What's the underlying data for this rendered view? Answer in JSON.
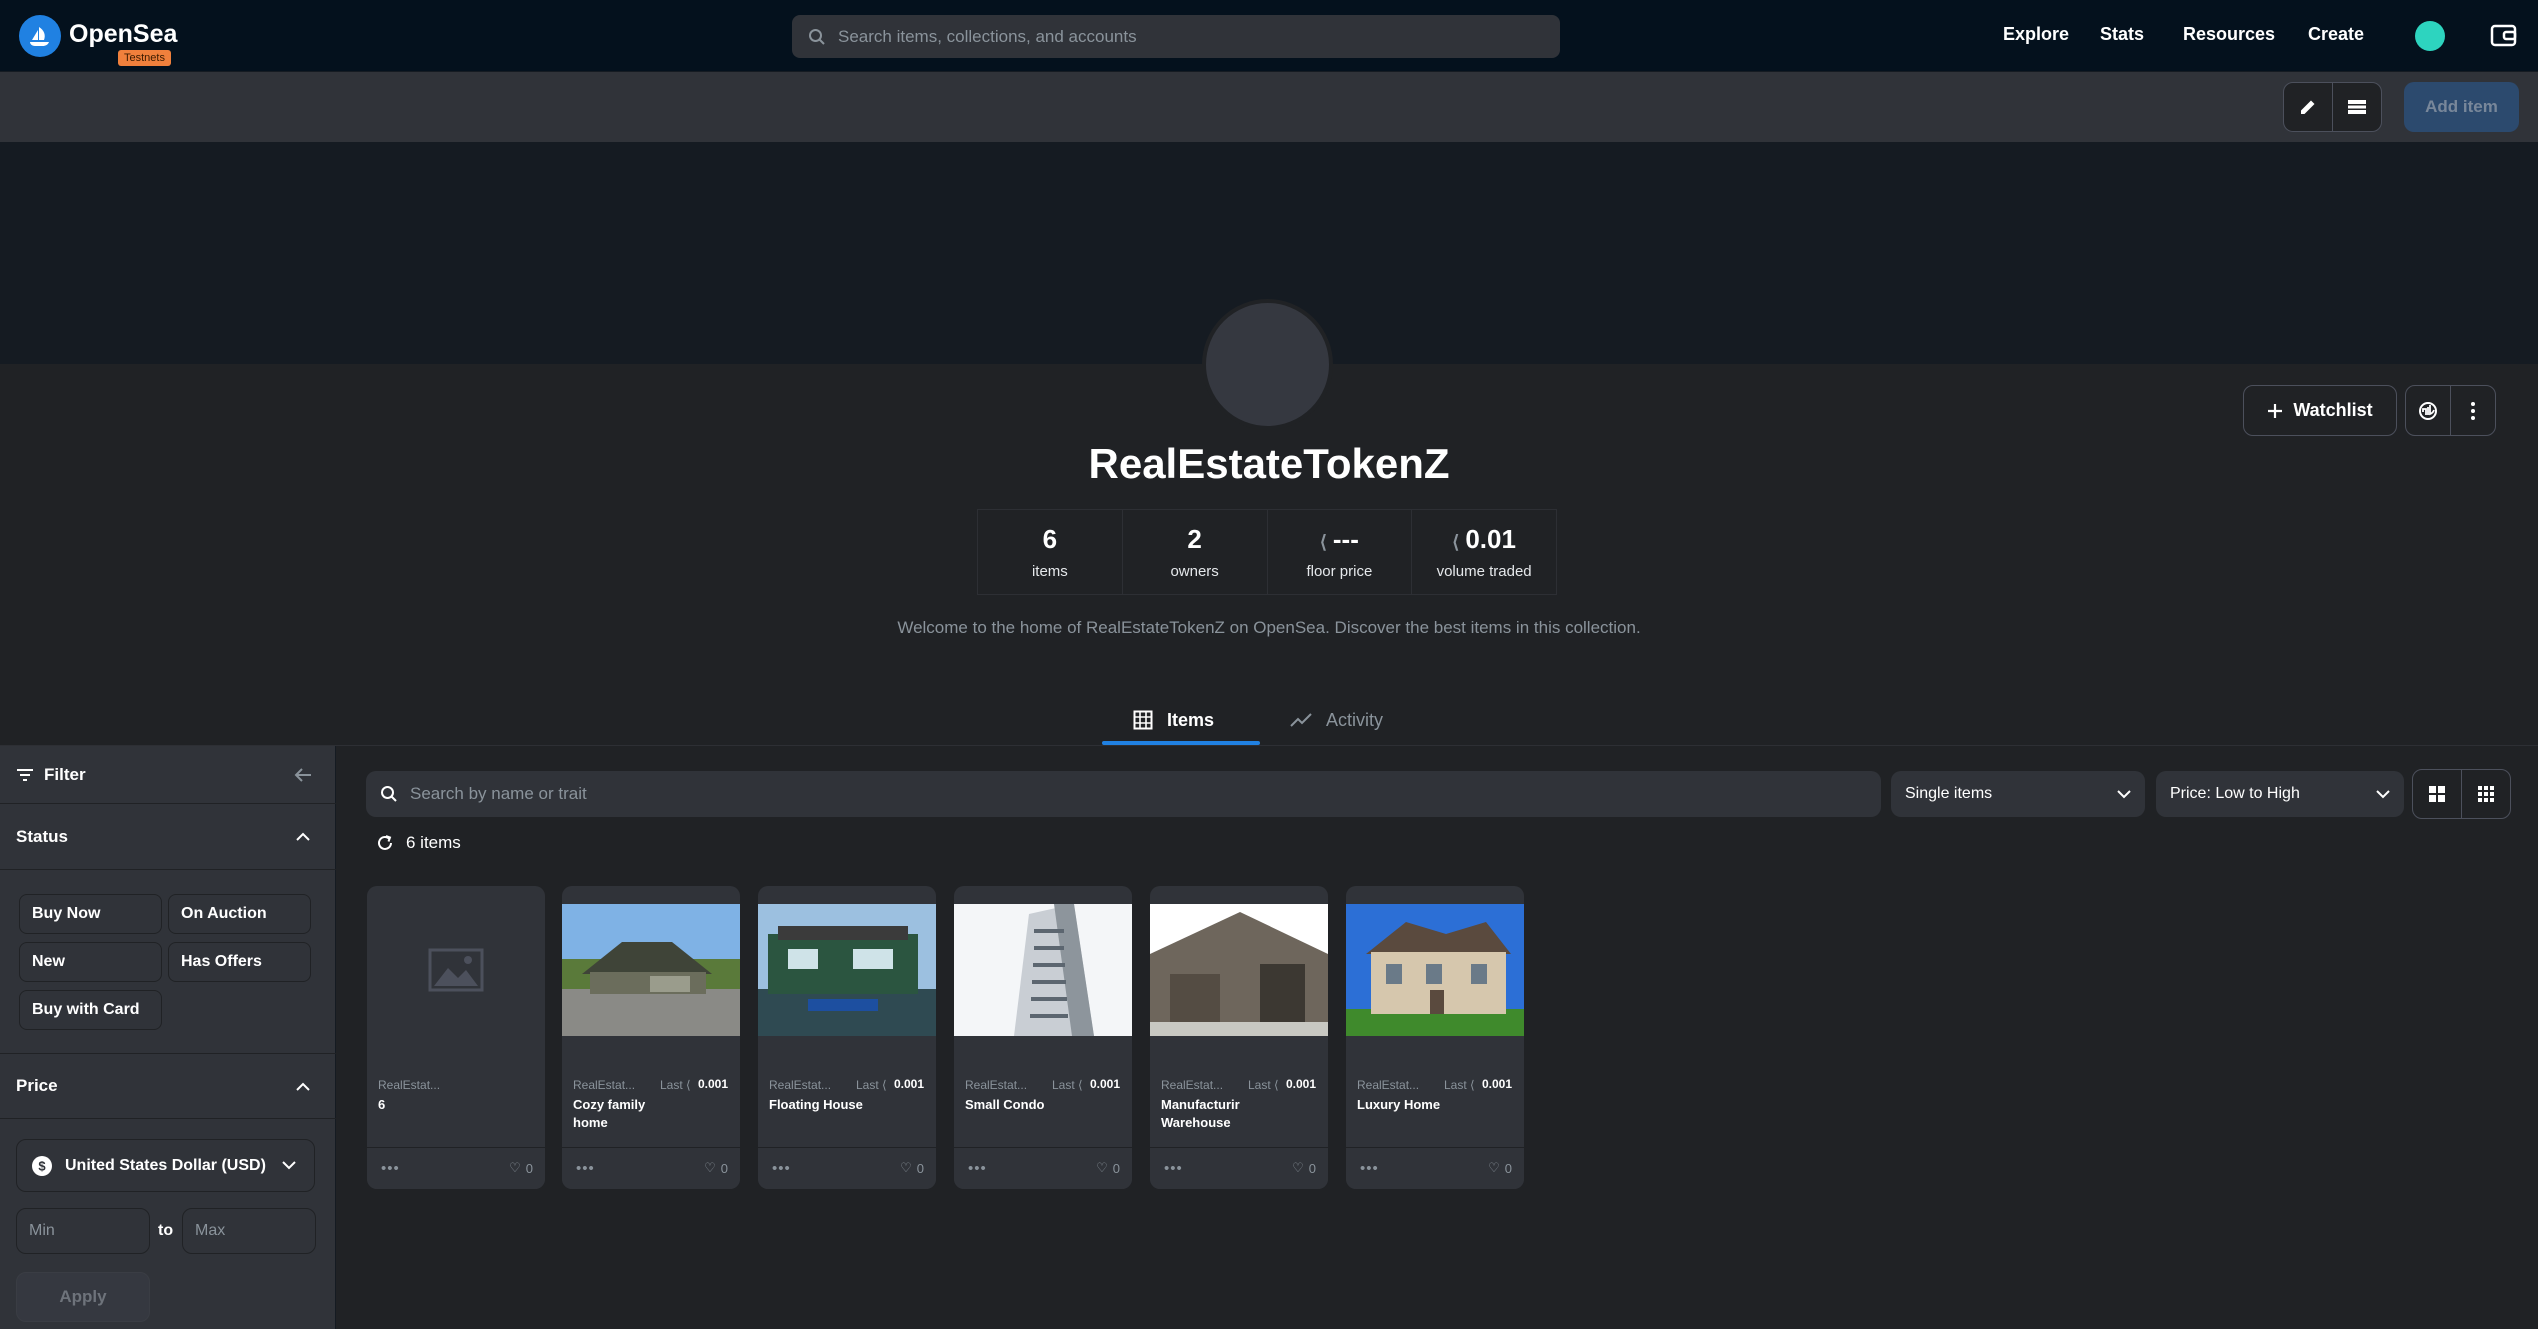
{
  "nav": {
    "brand": "OpenSea",
    "badge": "Testnets",
    "search_placeholder": "Search items, collections, and accounts",
    "links": [
      "Explore",
      "Stats",
      "Resources",
      "Create"
    ]
  },
  "toolbar": {
    "add_item": "Add item"
  },
  "collection": {
    "name": "RealEstateTokenZ",
    "stats": [
      {
        "value": "6",
        "label": "items"
      },
      {
        "value": "2",
        "label": "owners"
      },
      {
        "value": "---",
        "label": "floor price"
      },
      {
        "value": "0.01",
        "label": "volume traded"
      }
    ],
    "description": "Welcome to the home of RealEstateTokenZ on OpenSea. Discover the best items in this collection.",
    "watchlist": "Watchlist"
  },
  "tabs": [
    {
      "label": "Items"
    },
    {
      "label": "Activity"
    }
  ],
  "sidebar": {
    "filter": "Filter",
    "status_title": "Status",
    "status_chips": [
      "Buy Now",
      "On Auction",
      "New",
      "Has Offers",
      "Buy with Card"
    ],
    "price_title": "Price",
    "currency": "United States Dollar (USD)",
    "min_placeholder": "Min",
    "to": "to",
    "max_placeholder": "Max",
    "apply": "Apply"
  },
  "items_toolbar": {
    "search_placeholder": "Search by name or trait",
    "type_select": "Single items",
    "sort_select": "Price: Low to High",
    "count": "6 items"
  },
  "cards": [
    {
      "collection": "RealEstat...",
      "name": "6",
      "last_label": "",
      "last_price": "",
      "likes": "0",
      "image": "placeholder"
    },
    {
      "collection": "RealEstat...",
      "name": "Cozy family home",
      "last_label": "Last",
      "last_price": "0.001",
      "likes": "0",
      "image": "house"
    },
    {
      "collection": "RealEstat...",
      "name": "Floating House",
      "last_label": "Last",
      "last_price": "0.001",
      "likes": "0",
      "image": "houseboat"
    },
    {
      "collection": "RealEstat...",
      "name": "Small Condo",
      "last_label": "Last",
      "last_price": "0.001",
      "likes": "0",
      "image": "condo"
    },
    {
      "collection": "RealEstat...",
      "name": "Manufacturir Warehouse",
      "last_label": "Last",
      "last_price": "0.001",
      "likes": "0",
      "image": "warehouse"
    },
    {
      "collection": "RealEstat...",
      "name": "Luxury Home",
      "last_label": "Last",
      "last_price": "0.001",
      "likes": "0",
      "image": "mansion"
    }
  ],
  "colors": {
    "accent": "#2081e2",
    "nav_bg": "#04111d",
    "page_bg": "#202225",
    "panel": "#303339"
  }
}
